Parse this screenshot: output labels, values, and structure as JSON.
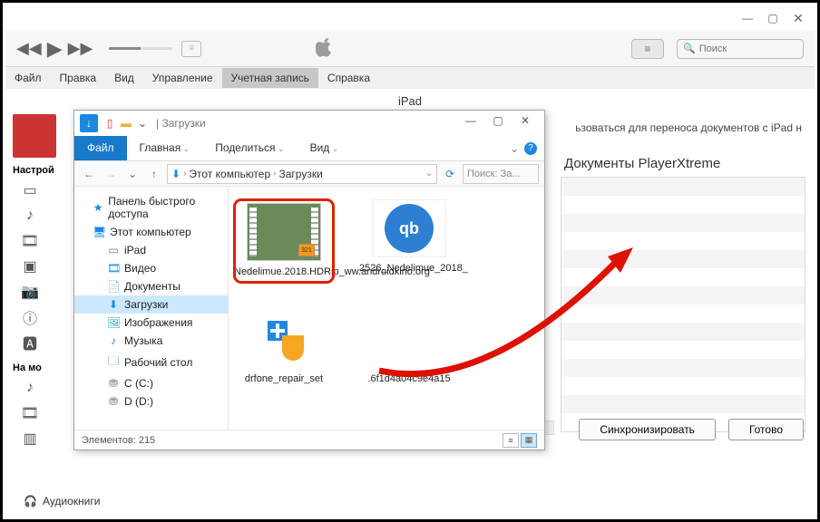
{
  "itunes": {
    "menu": [
      "Файл",
      "Правка",
      "Вид",
      "Управление",
      "Учетная запись",
      "Справка"
    ],
    "menu_active_idx": 4,
    "subheader": "iPad",
    "search_placeholder": "Поиск",
    "left_labels": {
      "settings": "Настрой",
      "on_device": "На мо"
    },
    "info_text": "ьзоваться для переноса документов с iPad н",
    "doc_title": "Документы PlayerXtreme",
    "bottom_item": "Аудиокниги",
    "buttons": {
      "sync": "Синхронизировать",
      "done": "Готово"
    },
    "storage_segments": [
      {
        "w": "12%",
        "c": "#3cc3ee"
      },
      {
        "w": "28%",
        "c": "#76d26b"
      },
      {
        "w": "8%",
        "c": "#f6c945"
      },
      {
        "w": "6%",
        "c": "#e86aa9"
      },
      {
        "w": "6%",
        "c": "#b06fd6"
      },
      {
        "w": "40%",
        "c": "#f0f0f0"
      }
    ]
  },
  "explorer": {
    "title_text": "Загрузки",
    "ribbon": {
      "file": "Файл",
      "home": "Главная",
      "share": "Поделиться",
      "view": "Вид"
    },
    "breadcrumb": [
      "Этот компьютер",
      "Загрузки"
    ],
    "search_placeholder": "Поиск: За...",
    "tree": [
      {
        "icon": "★",
        "color": "#1e88e5",
        "label": "Панель быстрого доступа",
        "lvl": 1
      },
      {
        "icon": "🖥",
        "color": "#1e88e5",
        "label": "Этот компьютер",
        "lvl": 1
      },
      {
        "icon": "▭",
        "color": "#777",
        "label": "iPad",
        "lvl": 2
      },
      {
        "icon": "🎞",
        "color": "#1e88e5",
        "label": "Видео",
        "lvl": 2
      },
      {
        "icon": "📄",
        "color": "#6aa9dc",
        "label": "Документы",
        "lvl": 2
      },
      {
        "icon": "⬇",
        "color": "#1b87e0",
        "label": "Загрузки",
        "lvl": 2,
        "sel": true
      },
      {
        "icon": "🖼",
        "color": "#2aa0b0",
        "label": "Изображения",
        "lvl": 2
      },
      {
        "icon": "♪",
        "color": "#1e88e5",
        "label": "Музыка",
        "lvl": 2
      },
      {
        "icon": "🗔",
        "color": "#1e88e5",
        "label": "Рабочий стол",
        "lvl": 2
      },
      {
        "icon": "⛃",
        "color": "#888",
        "label": "C (C:)",
        "lvl": 2
      },
      {
        "icon": "⛃",
        "color": "#888",
        "label": "D (D:)",
        "lvl": 2
      }
    ],
    "files": {
      "f1": "Nedelimue.2018.HDRip_ww.androidkino.org",
      "f2": "2526_Nedelimue_2018_",
      "f3": "drfone_repair_set",
      "f4": ".6f1d4a04c9e4a15"
    },
    "status": "Элементов: 215"
  }
}
